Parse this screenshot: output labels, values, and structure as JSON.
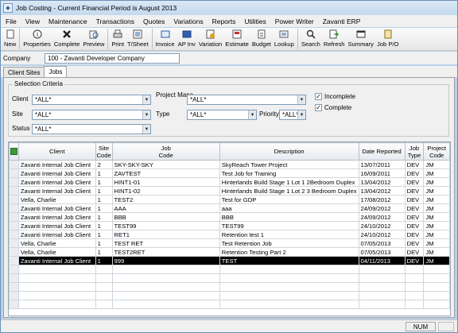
{
  "window": {
    "title": "Job Costing - Current Financial Period is August 2013"
  },
  "menu": [
    "File",
    "View",
    "Maintenance",
    "Transactions",
    "Quotes",
    "Variations",
    "Reports",
    "Utilities",
    "Power Writer",
    "Zavanti ERP"
  ],
  "toolbar": [
    {
      "label": "New",
      "icon": "new-doc-icon"
    },
    {
      "label": "Properties",
      "icon": "info-icon"
    },
    {
      "label": "Complete",
      "icon": "cross-icon"
    },
    {
      "label": "Preview",
      "icon": "preview-icon"
    },
    {
      "label": "Print",
      "icon": "printer-icon"
    },
    {
      "label": "T/Sheet",
      "icon": "timesheet-icon"
    },
    {
      "label": "Invoice",
      "icon": "invoice-icon"
    },
    {
      "label": "AP Inv",
      "icon": "ap-invoice-icon"
    },
    {
      "label": "Variation",
      "icon": "variation-icon"
    },
    {
      "label": "Estimate",
      "icon": "estimate-icon"
    },
    {
      "label": "Budget",
      "icon": "budget-icon"
    },
    {
      "label": "Lookup",
      "icon": "lookup-icon"
    },
    {
      "label": "Search",
      "icon": "search-icon"
    },
    {
      "label": "Refresh",
      "icon": "refresh-icon"
    },
    {
      "label": "Summary",
      "icon": "summary-icon"
    },
    {
      "label": "Job P/O",
      "icon": "job-po-icon"
    }
  ],
  "company": {
    "label": "Company",
    "value": "100 - Zavanti Developer Company"
  },
  "tabs": [
    {
      "label": "Client Sites",
      "active": false
    },
    {
      "label": "Jobs",
      "active": true
    }
  ],
  "criteria": {
    "title": "Selection Criteria",
    "client_label": "Client",
    "client_value": "*ALL*",
    "pm_label": "Project Mana",
    "pm_value": "*ALL*",
    "site_label": "Site",
    "site_value": "*ALL*",
    "type_label": "Type",
    "type_value": "*ALL*",
    "priority_label": "Priority",
    "priority_value": "*ALL*",
    "status_label": "Status",
    "status_value": "*ALL*",
    "incomplete_label": "Incomplete",
    "incomplete_checked": true,
    "complete_label": "Complete",
    "complete_checked": true
  },
  "grid": {
    "columns": [
      "Client",
      "Site\nCode",
      "Job\nCode",
      "Description",
      "Date Reported",
      "Job\nType",
      "Project\nCode"
    ],
    "rows": [
      [
        "Zavanti Internal Job Client",
        "2",
        "SKY-SKY-SKY",
        "SkyReach Tower Project",
        "13/07/2011",
        "DEV",
        "JM"
      ],
      [
        "Zavanti Internal Job Client",
        "1",
        "ZAVTEST",
        "Test Job for Training",
        "16/09/2011",
        "DEV",
        "JM"
      ],
      [
        "Zavanti Internal Job Client",
        "1",
        "HINT1-01",
        "Hinterlands Build Stage 1 Lot 1 2Bedroom Duplex",
        "13/04/2012",
        "DEV",
        "JM"
      ],
      [
        "Zavanti Internal Job Client",
        "1",
        "HINT1-02",
        "Hinterlands Build Stage 1 Lot 2 3 Bedroom Duplex",
        "13/04/2012",
        "DEV",
        "JM"
      ],
      [
        "Vella, Charlie",
        "1",
        "TEST2",
        "Test for GDP",
        "17/08/2012",
        "DEV",
        "JM"
      ],
      [
        "Zavanti Internal Job Client",
        "1",
        "AAA",
        "aaa",
        "24/09/2012",
        "DEV",
        "JM"
      ],
      [
        "Zavanti Internal Job Client",
        "1",
        "BBB",
        "BBB",
        "24/09/2012",
        "DEV",
        "JM"
      ],
      [
        "Zavanti Internal Job Client",
        "1",
        "TEST99",
        "TEST99",
        "24/10/2012",
        "DEV",
        "JM"
      ],
      [
        "Zavanti Internal Job Client",
        "1",
        "RET1",
        "Retention test 1",
        "24/10/2012",
        "DEV",
        "JM"
      ],
      [
        "Vella, Charlie",
        "1",
        "TEST RET",
        "Test Retention Job",
        "07/05/2013",
        "DEV",
        "JM"
      ],
      [
        "Vella, Charlie",
        "1",
        "TEST2RET",
        "Retention Testing Part 2",
        "07/05/2013",
        "DEV",
        "JM"
      ],
      [
        "Zavanti Internal Job Client",
        "1",
        "999",
        "TEST",
        "04/11/2013",
        "DEV",
        "JM"
      ]
    ],
    "selected_row": 11,
    "blank_rows": 5
  },
  "status": {
    "num": "NUM"
  }
}
